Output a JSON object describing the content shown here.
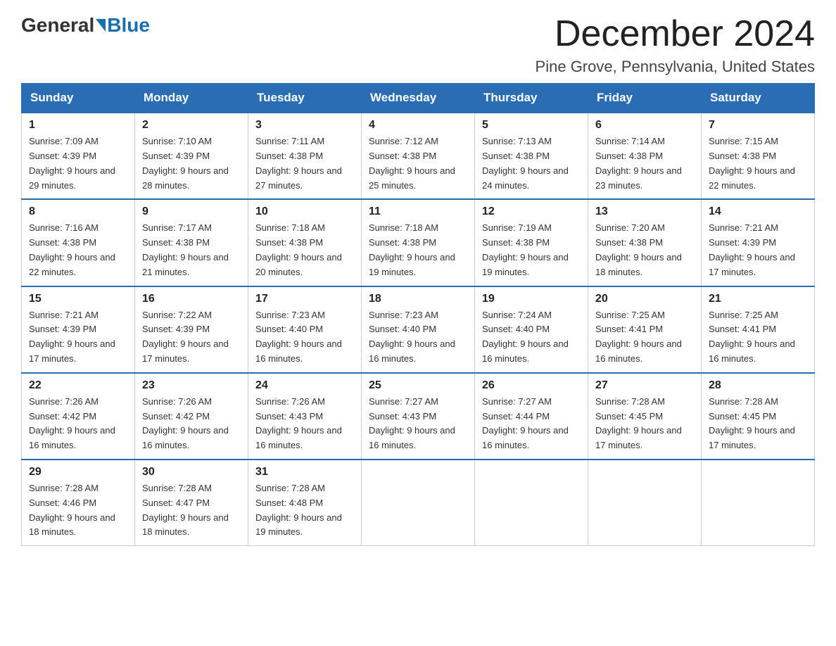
{
  "header": {
    "logo_general": "General",
    "logo_blue": "Blue",
    "month_title": "December 2024",
    "location": "Pine Grove, Pennsylvania, United States"
  },
  "weekdays": [
    "Sunday",
    "Monday",
    "Tuesday",
    "Wednesday",
    "Thursday",
    "Friday",
    "Saturday"
  ],
  "weeks": [
    [
      {
        "day": "1",
        "sunrise": "7:09 AM",
        "sunset": "4:39 PM",
        "daylight": "9 hours and 29 minutes."
      },
      {
        "day": "2",
        "sunrise": "7:10 AM",
        "sunset": "4:39 PM",
        "daylight": "9 hours and 28 minutes."
      },
      {
        "day": "3",
        "sunrise": "7:11 AM",
        "sunset": "4:38 PM",
        "daylight": "9 hours and 27 minutes."
      },
      {
        "day": "4",
        "sunrise": "7:12 AM",
        "sunset": "4:38 PM",
        "daylight": "9 hours and 25 minutes."
      },
      {
        "day": "5",
        "sunrise": "7:13 AM",
        "sunset": "4:38 PM",
        "daylight": "9 hours and 24 minutes."
      },
      {
        "day": "6",
        "sunrise": "7:14 AM",
        "sunset": "4:38 PM",
        "daylight": "9 hours and 23 minutes."
      },
      {
        "day": "7",
        "sunrise": "7:15 AM",
        "sunset": "4:38 PM",
        "daylight": "9 hours and 22 minutes."
      }
    ],
    [
      {
        "day": "8",
        "sunrise": "7:16 AM",
        "sunset": "4:38 PM",
        "daylight": "9 hours and 22 minutes."
      },
      {
        "day": "9",
        "sunrise": "7:17 AM",
        "sunset": "4:38 PM",
        "daylight": "9 hours and 21 minutes."
      },
      {
        "day": "10",
        "sunrise": "7:18 AM",
        "sunset": "4:38 PM",
        "daylight": "9 hours and 20 minutes."
      },
      {
        "day": "11",
        "sunrise": "7:18 AM",
        "sunset": "4:38 PM",
        "daylight": "9 hours and 19 minutes."
      },
      {
        "day": "12",
        "sunrise": "7:19 AM",
        "sunset": "4:38 PM",
        "daylight": "9 hours and 19 minutes."
      },
      {
        "day": "13",
        "sunrise": "7:20 AM",
        "sunset": "4:38 PM",
        "daylight": "9 hours and 18 minutes."
      },
      {
        "day": "14",
        "sunrise": "7:21 AM",
        "sunset": "4:39 PM",
        "daylight": "9 hours and 17 minutes."
      }
    ],
    [
      {
        "day": "15",
        "sunrise": "7:21 AM",
        "sunset": "4:39 PM",
        "daylight": "9 hours and 17 minutes."
      },
      {
        "day": "16",
        "sunrise": "7:22 AM",
        "sunset": "4:39 PM",
        "daylight": "9 hours and 17 minutes."
      },
      {
        "day": "17",
        "sunrise": "7:23 AM",
        "sunset": "4:40 PM",
        "daylight": "9 hours and 16 minutes."
      },
      {
        "day": "18",
        "sunrise": "7:23 AM",
        "sunset": "4:40 PM",
        "daylight": "9 hours and 16 minutes."
      },
      {
        "day": "19",
        "sunrise": "7:24 AM",
        "sunset": "4:40 PM",
        "daylight": "9 hours and 16 minutes."
      },
      {
        "day": "20",
        "sunrise": "7:25 AM",
        "sunset": "4:41 PM",
        "daylight": "9 hours and 16 minutes."
      },
      {
        "day": "21",
        "sunrise": "7:25 AM",
        "sunset": "4:41 PM",
        "daylight": "9 hours and 16 minutes."
      }
    ],
    [
      {
        "day": "22",
        "sunrise": "7:26 AM",
        "sunset": "4:42 PM",
        "daylight": "9 hours and 16 minutes."
      },
      {
        "day": "23",
        "sunrise": "7:26 AM",
        "sunset": "4:42 PM",
        "daylight": "9 hours and 16 minutes."
      },
      {
        "day": "24",
        "sunrise": "7:26 AM",
        "sunset": "4:43 PM",
        "daylight": "9 hours and 16 minutes."
      },
      {
        "day": "25",
        "sunrise": "7:27 AM",
        "sunset": "4:43 PM",
        "daylight": "9 hours and 16 minutes."
      },
      {
        "day": "26",
        "sunrise": "7:27 AM",
        "sunset": "4:44 PM",
        "daylight": "9 hours and 16 minutes."
      },
      {
        "day": "27",
        "sunrise": "7:28 AM",
        "sunset": "4:45 PM",
        "daylight": "9 hours and 17 minutes."
      },
      {
        "day": "28",
        "sunrise": "7:28 AM",
        "sunset": "4:45 PM",
        "daylight": "9 hours and 17 minutes."
      }
    ],
    [
      {
        "day": "29",
        "sunrise": "7:28 AM",
        "sunset": "4:46 PM",
        "daylight": "9 hours and 18 minutes."
      },
      {
        "day": "30",
        "sunrise": "7:28 AM",
        "sunset": "4:47 PM",
        "daylight": "9 hours and 18 minutes."
      },
      {
        "day": "31",
        "sunrise": "7:28 AM",
        "sunset": "4:48 PM",
        "daylight": "9 hours and 19 minutes."
      },
      null,
      null,
      null,
      null
    ]
  ]
}
